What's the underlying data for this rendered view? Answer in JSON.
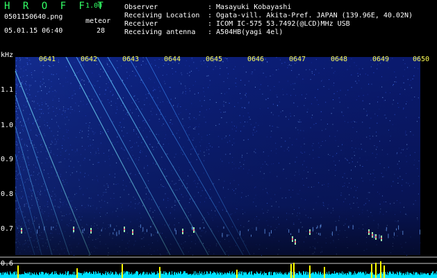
{
  "header": {
    "app_title": "H R O F F T",
    "version": "1.00",
    "filename": "0501150640.png",
    "datetime": "05.01.15 06:40",
    "meteor_label": "meteor",
    "meteor_count": "28"
  },
  "info": [
    {
      "key": "Observer",
      "value": ": Masayuki Kobayashi"
    },
    {
      "key": "Receiving Location",
      "value": ": Ogata-vill. Akita-Pref. JAPAN (139.96E, 40.02N)"
    },
    {
      "key": "Receiver",
      "value": ": ICOM IC-575 53.7492(@LCD)MHz USB"
    },
    {
      "key": "Receiving antenna",
      "value": ": A504HB(yagi 4el)"
    }
  ],
  "axis": {
    "y_unit": "kHz",
    "y_labels": [
      "1.1",
      "1.0",
      "0.9",
      "0.8",
      "0.7",
      "0.6"
    ],
    "x_labels": [
      "0641",
      "0642",
      "0643",
      "0644",
      "0645",
      "0646",
      "0647",
      "0648",
      "0649",
      "0650"
    ]
  },
  "colors": {
    "background": "#000000",
    "spectrogram_base": "#0a1a6e",
    "trail": "#9fd8ff",
    "level_bar": "#00e0ff",
    "meteor_spike": "#ffff00",
    "tick_text": "#ffff55",
    "title_text": "#33ff66"
  }
}
